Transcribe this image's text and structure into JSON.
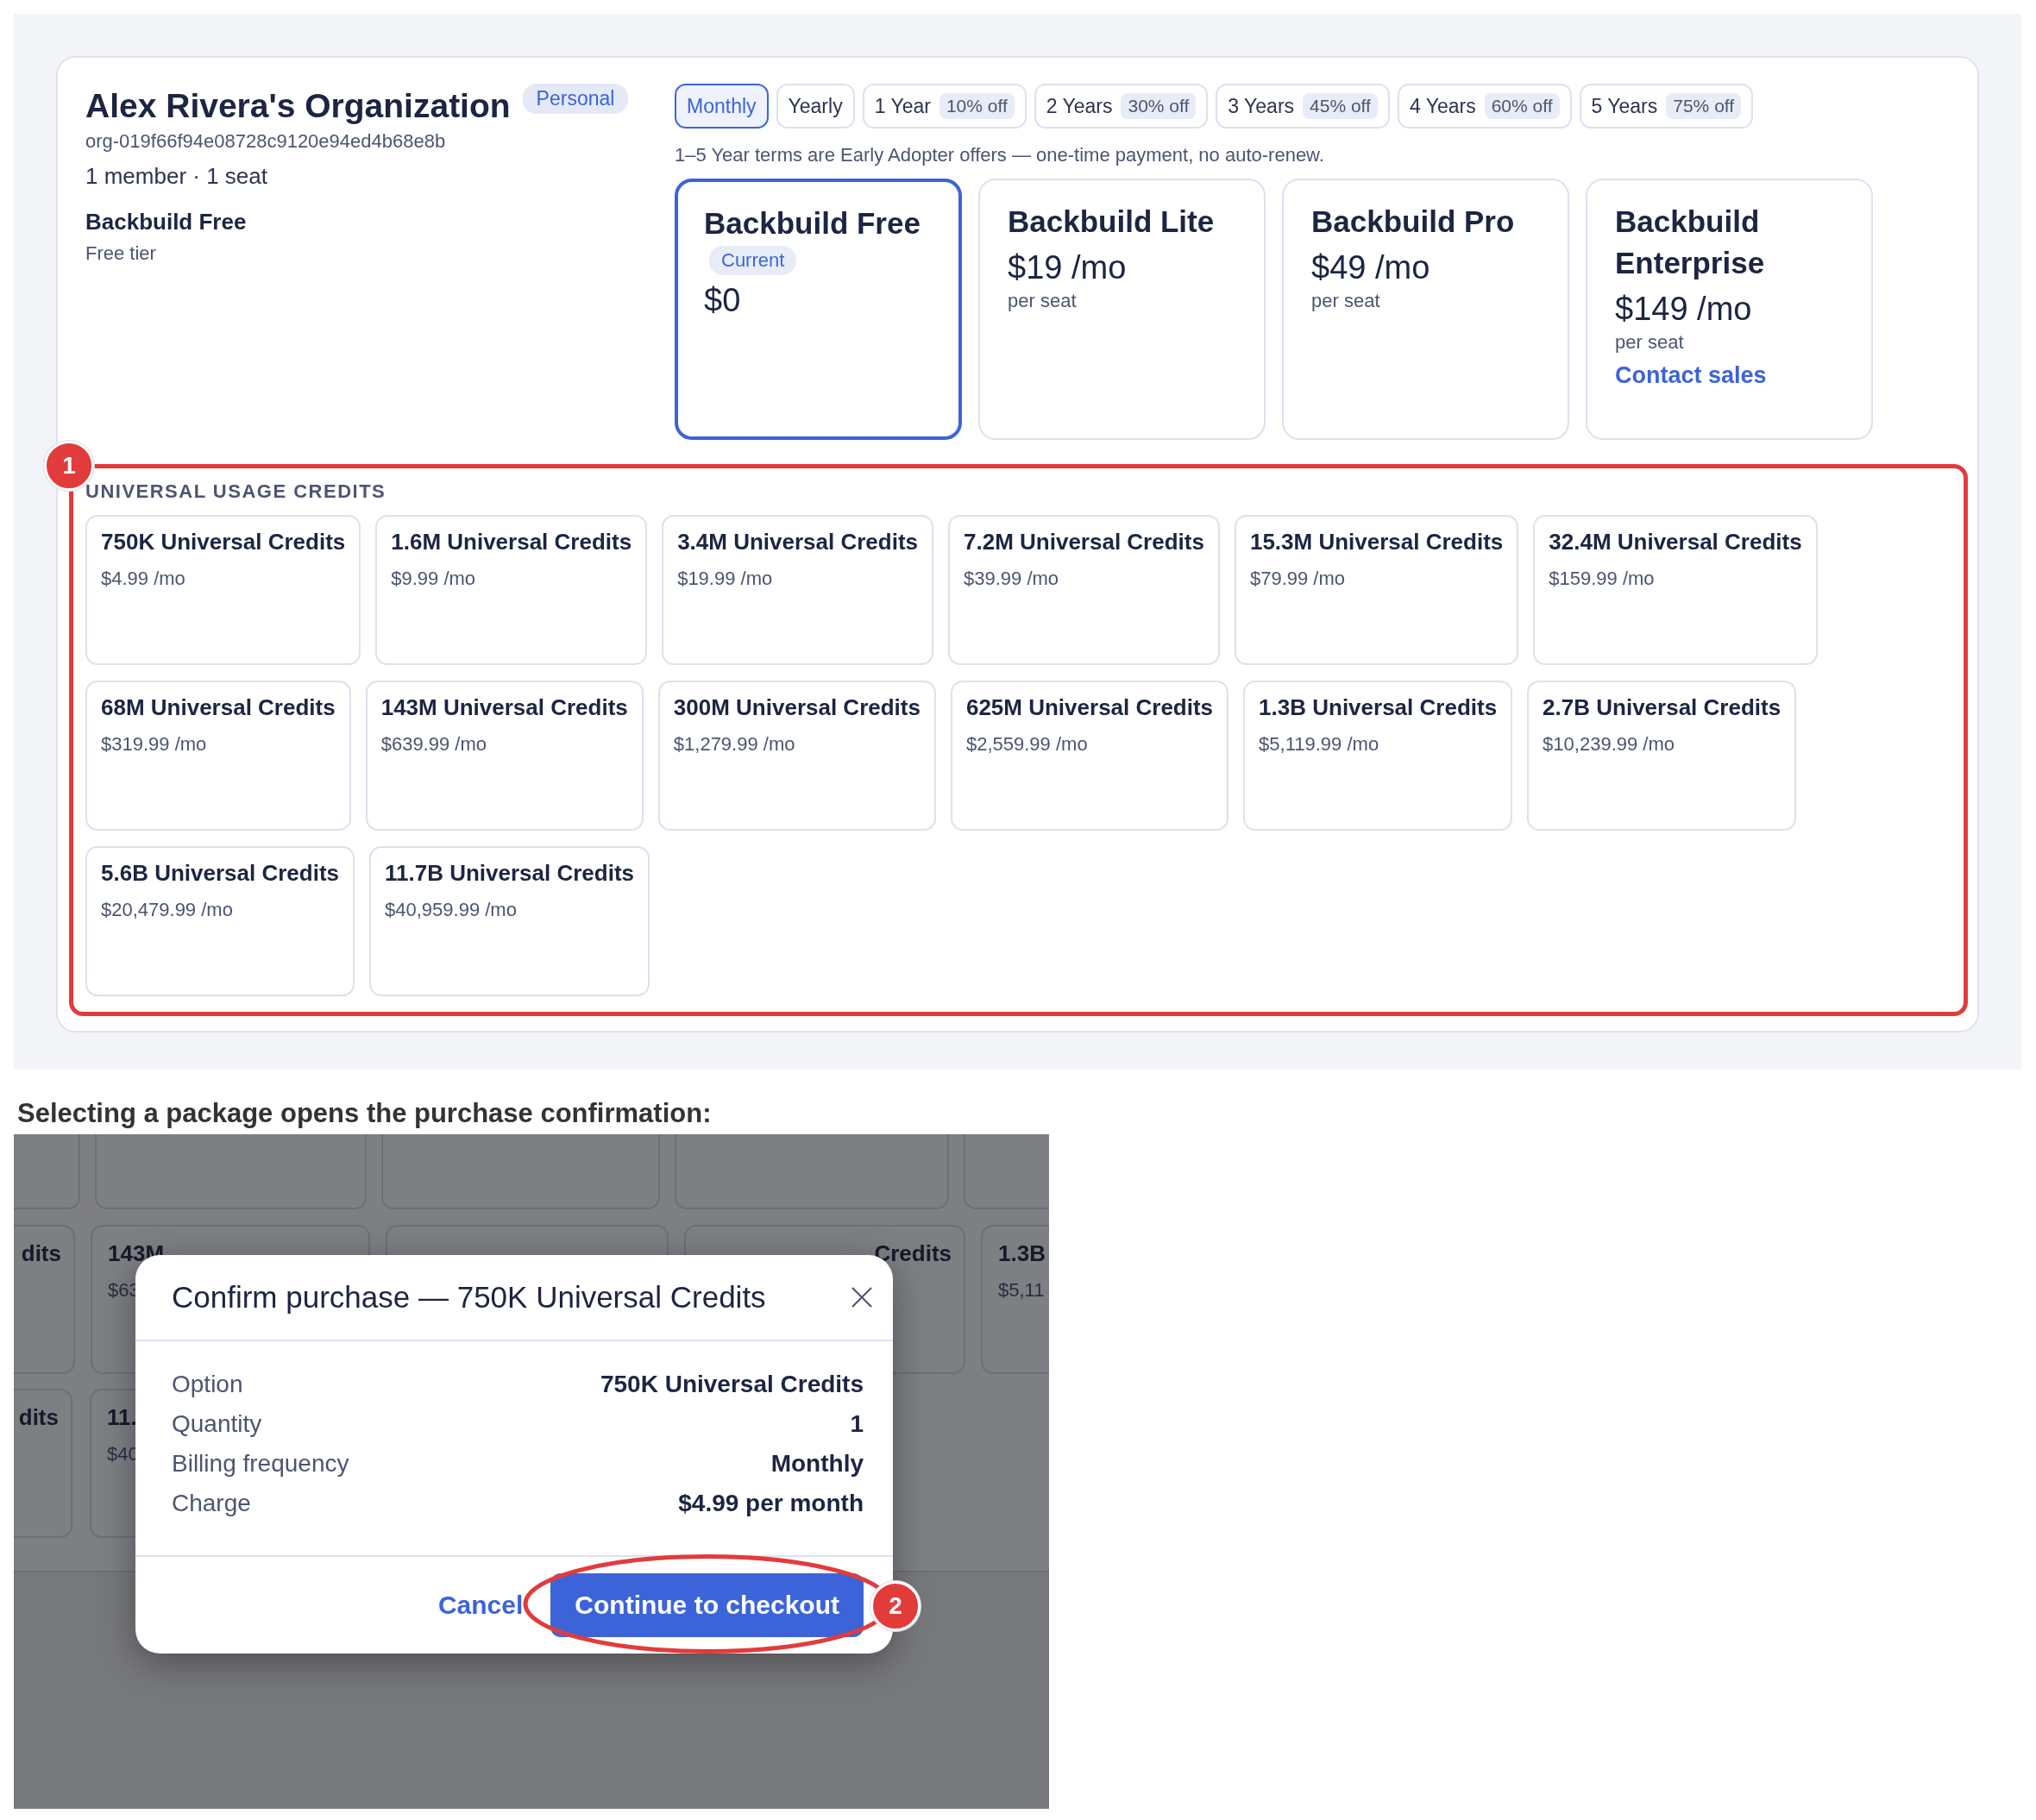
{
  "org": {
    "name": "Alex Rivera's Organization",
    "badge": "Personal",
    "id": "org-019f66f94e08728c9120e94ed4b68e8b",
    "members": "1 member · 1 seat",
    "plan": "Backbuild Free",
    "plan_note": "Free tier"
  },
  "billing_tabs": [
    {
      "label": "Monthly",
      "selected": true
    },
    {
      "label": "Yearly",
      "selected": false
    },
    {
      "label": "1 Year",
      "discount": "10% off",
      "selected": false
    },
    {
      "label": "2 Years",
      "discount": "30% off",
      "selected": false
    },
    {
      "label": "3 Years",
      "discount": "45% off",
      "selected": false
    },
    {
      "label": "4 Years",
      "discount": "60% off",
      "selected": false
    },
    {
      "label": "5 Years",
      "discount": "75% off",
      "selected": false
    }
  ],
  "billing_note": "1–5 Year terms are Early Adopter offers — one-time payment, no auto-renew.",
  "plans": [
    {
      "name": "Backbuild Free",
      "badge": "Current",
      "price": "$0",
      "selected": true
    },
    {
      "name": "Backbuild Lite",
      "price": "$19 /mo",
      "unit": "per seat",
      "selected": false
    },
    {
      "name": "Backbuild Pro",
      "price": "$49 /mo",
      "unit": "per seat",
      "selected": false
    },
    {
      "name": "Backbuild Enterprise",
      "price": "$149 /mo",
      "unit": "per seat",
      "link": "Contact sales",
      "selected": false
    }
  ],
  "credits": {
    "marker": "1",
    "title": "UNIVERSAL USAGE CREDITS",
    "packages": [
      {
        "name": "750K Universal Credits",
        "price": "$4.99 /mo"
      },
      {
        "name": "1.6M Universal Credits",
        "price": "$9.99 /mo"
      },
      {
        "name": "3.4M Universal Credits",
        "price": "$19.99 /mo"
      },
      {
        "name": "7.2M Universal Credits",
        "price": "$39.99 /mo"
      },
      {
        "name": "15.3M Universal Credits",
        "price": "$79.99 /mo"
      },
      {
        "name": "32.4M Universal Credits",
        "price": "$159.99 /mo"
      },
      {
        "name": "68M Universal Credits",
        "price": "$319.99 /mo"
      },
      {
        "name": "143M Universal Credits",
        "price": "$639.99 /mo"
      },
      {
        "name": "300M Universal Credits",
        "price": "$1,279.99 /mo"
      },
      {
        "name": "625M Universal Credits",
        "price": "$2,559.99 /mo"
      },
      {
        "name": "1.3B Universal Credits",
        "price": "$5,119.99 /mo"
      },
      {
        "name": "2.7B Universal Credits",
        "price": "$10,239.99 /mo"
      },
      {
        "name": "5.6B Universal Credits",
        "price": "$20,479.99 /mo"
      },
      {
        "name": "11.7B Universal Credits",
        "price": "$40,959.99 /mo"
      }
    ]
  },
  "caption": "Selecting a package opens the purchase confirmation:",
  "backdrop": {
    "rows": [
      {
        "cards": [
          {
            "kind": "blank"
          },
          {
            "kind": "blank"
          },
          {
            "kind": "blank"
          },
          {
            "kind": "blank"
          },
          {
            "kind": "blank"
          }
        ]
      },
      {
        "cards": [
          {
            "kind": "cut",
            "title": "dits"
          },
          {
            "kind": "text",
            "title": "143M",
            "price": "$63"
          },
          {
            "kind": "blank"
          },
          {
            "kind": "cut",
            "title": "Credits"
          },
          {
            "kind": "text",
            "title": "1.3B",
            "price": "$5,11"
          }
        ]
      },
      {
        "cards": [
          {
            "kind": "cut",
            "title": "dits"
          },
          {
            "kind": "text",
            "title": "11.",
            "price": "$40"
          }
        ]
      }
    ]
  },
  "dialog": {
    "title": "Confirm purchase — 750K Universal Credits",
    "rows": [
      {
        "label": "Option",
        "value": "750K Universal Credits"
      },
      {
        "label": "Quantity",
        "value": "1"
      },
      {
        "label": "Billing frequency",
        "value": "Monthly"
      },
      {
        "label": "Charge",
        "value": "$4.99 per month"
      }
    ],
    "cancel": "Cancel",
    "confirm": "Continue to checkout",
    "marker": "2"
  }
}
